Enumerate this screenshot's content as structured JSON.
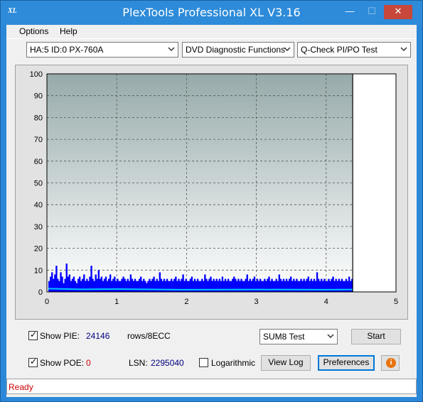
{
  "window": {
    "title": "PlexTools Professional XL V3.16",
    "logo_text": "XL",
    "minimize": "—",
    "maximize": "☐",
    "close": "✕"
  },
  "menu": {
    "options": "Options",
    "help": "Help"
  },
  "toolbar": {
    "drive": "HA:5 ID:0  PX-760A",
    "function": "DVD Diagnostic Functions",
    "test": "Q-Check PI/PO Test"
  },
  "chart_data": {
    "type": "bar",
    "xlim": [
      0,
      5
    ],
    "ylim": [
      0,
      100
    ],
    "x_ticks": [
      "0",
      "1",
      "2",
      "3",
      "4",
      "5"
    ],
    "y_ticks": [
      "0",
      "10",
      "20",
      "30",
      "40",
      "50",
      "60",
      "70",
      "80",
      "90",
      "100"
    ],
    "grid": true,
    "scan_end_marker_x": 4.38,
    "series": [
      {
        "color": "#0000ff",
        "x_start": 0.02,
        "x_end": 4.38,
        "values": [
          5,
          7,
          9,
          6,
          8,
          12,
          6,
          5,
          9,
          7,
          4,
          6,
          13,
          7,
          8,
          5,
          6,
          7,
          5,
          4,
          6,
          7,
          5,
          6,
          8,
          5,
          6,
          5,
          7,
          12,
          6,
          5,
          8,
          6,
          10,
          6,
          7,
          5,
          6,
          7,
          5,
          6,
          8,
          5,
          6,
          7,
          5,
          6,
          5,
          5,
          6,
          7,
          6,
          5,
          6,
          5,
          8,
          6,
          5,
          6,
          5,
          5,
          6,
          7,
          5,
          6,
          5,
          4,
          5,
          6,
          5,
          6,
          7,
          5,
          6,
          5,
          9,
          6,
          5,
          6,
          5,
          6,
          5,
          5,
          6,
          5,
          6,
          7,
          5,
          6,
          5,
          6,
          8,
          5,
          6,
          5,
          5,
          6,
          7,
          5,
          6,
          5,
          6,
          5,
          5,
          6,
          5,
          8,
          6,
          5,
          6,
          7,
          5,
          6,
          5,
          6,
          5,
          6,
          5,
          7,
          5,
          6,
          5,
          6,
          5,
          5,
          6,
          7,
          6,
          5,
          6,
          5,
          6,
          5,
          5,
          6,
          8,
          5,
          6,
          5,
          6,
          7,
          5,
          6,
          5,
          6,
          5,
          5,
          6,
          5,
          6,
          7,
          5,
          6,
          5,
          5,
          6,
          5,
          8,
          6,
          5,
          6,
          5,
          6,
          5,
          6,
          7,
          5,
          6,
          5,
          6,
          5,
          5,
          6,
          5,
          6,
          5,
          6,
          7,
          5,
          6,
          5,
          6,
          5,
          9,
          6,
          5,
          6,
          5,
          6,
          5,
          5,
          6,
          5,
          6,
          7,
          5,
          6,
          5,
          6,
          5,
          6,
          5,
          5,
          6,
          5,
          7,
          5,
          6
        ]
      },
      {
        "color": "#00c8ff",
        "x": [
          0.02,
          0.5,
          1.0,
          2.0,
          3.0,
          4.0,
          4.38
        ],
        "values": [
          1.5,
          1.2,
          1.3,
          1.0,
          1.1,
          1.0,
          1.1
        ]
      }
    ]
  },
  "controls": {
    "show_pie_label": "Show PIE:",
    "pie_value": "24146",
    "pie_unit": "rows/8ECC",
    "show_poe_label": "Show POE:",
    "poe_value": "0",
    "lsn_label": "LSN:",
    "lsn_value": "2295040",
    "logarithmic_label": "Logarithmic",
    "sum_test": "SUM8 Test",
    "start": "Start",
    "view_log": "View Log",
    "preferences": "Preferences",
    "info_glyph": "i"
  },
  "status": {
    "text": "Ready"
  }
}
